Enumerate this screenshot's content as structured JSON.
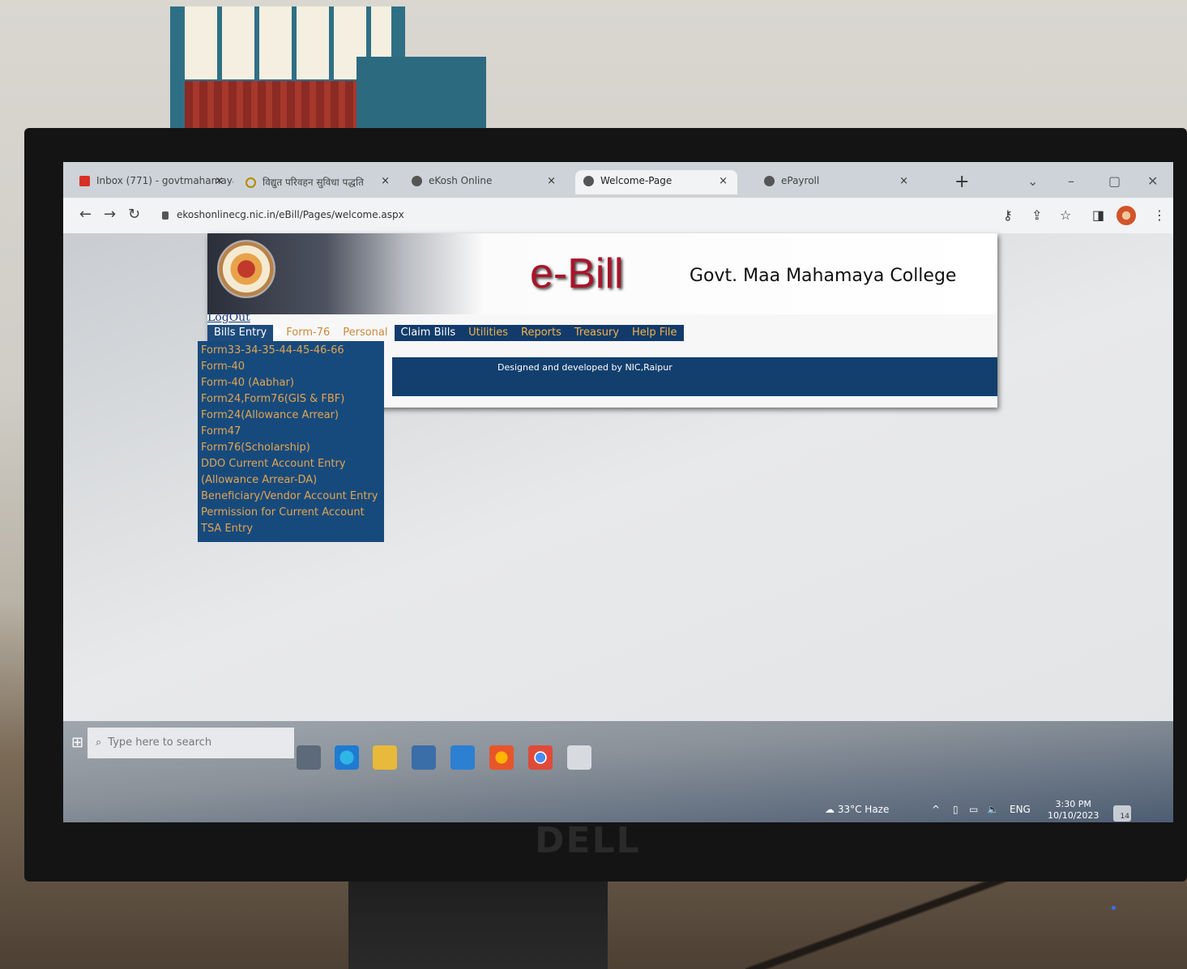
{
  "browser": {
    "tabs": [
      {
        "label": "Inbox (771) - govtmahamaya",
        "icon": "gmail-icon",
        "active": false
      },
      {
        "label": "विद्युत परिवहन सुविधा पद्धति",
        "icon": "info-icon",
        "active": false
      },
      {
        "label": "eKosh Online",
        "icon": "globe-icon",
        "active": false
      },
      {
        "label": "Welcome-Page",
        "icon": "globe-icon",
        "active": true
      },
      {
        "label": "ePayroll",
        "icon": "globe-icon",
        "active": false
      }
    ],
    "tab_close": "×",
    "new_tab": "+",
    "url": "ekoshonlinecg.nic.in/eBill/Pages/welcome.aspx"
  },
  "page": {
    "title": "e-Bill",
    "college": "Govt. Maa Mahamaya College",
    "logout": "LogOut",
    "menu": [
      "Bills Entry",
      "Form-76",
      "Personal",
      "Claim Bills",
      "Utilities",
      "Reports",
      "Treasury",
      "Help File"
    ],
    "submenu": [
      "Form33-34-35-44-45-46-66",
      "Form-40",
      "Form-40 (Aabhar)",
      "Form24,Form76(GIS & FBF)",
      "Form24(Allowance Arrear)",
      "Form47",
      "Form76(Scholarship)",
      "DDO Current Account Entry",
      "(Allowance Arrear-DA)",
      "Beneficiary/Vendor Account Entry",
      "Permission for Current Account",
      "TSA Entry"
    ],
    "credit": "Designed and developed by NIC,Raipur"
  },
  "taskbar": {
    "search_placeholder": "Type here to search",
    "weather": "33°C  Haze",
    "lang": "ENG",
    "time": "3:30 PM",
    "date": "10/10/2023",
    "notification_count": "14"
  },
  "monitor_brand": "DELL",
  "colors": {
    "menu_bg": "#123b6b",
    "menu_text": "#e2a552",
    "title_red": "#a8152a"
  }
}
